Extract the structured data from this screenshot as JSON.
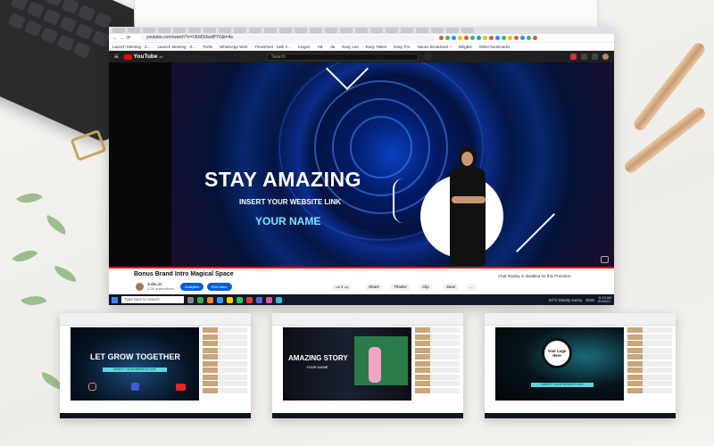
{
  "browser": {
    "url": "youtube.com/watch?v=VEMS0wdPY0&t=4s",
    "bookmarks": [
      "Launch Meeting - Z...",
      "Launch Meeting - Z...",
      "Trello",
      "WhatsApp Web",
      "Timesheet - task 2...",
      "Lingoo",
      "AB",
      "Jia",
      "Easy Lan",
      "Easy Talent",
      "Easy Pro",
      "Naomi Broadcast ~",
      "DiligBiz",
      "Other bookmarks"
    ]
  },
  "youtube": {
    "logo": "YouTube",
    "region": "MY",
    "search_placeholder": "Search",
    "video": {
      "headline": "STAY AMAZING",
      "subline": "INSERT YOUR WEBSITE LINK",
      "name": "YOUR NAME",
      "progress": 1.0
    },
    "title": "Bonus Brand Intro Magical Space",
    "channel": "JulieLim",
    "subscribers": "1.2K subscribers",
    "analytics_label": "Analytics",
    "edit_video_label": "Edit video",
    "likes": "4",
    "share_label": "Share",
    "thanks_label": "Thanks",
    "clip_label": "Clip",
    "save_label": "Save",
    "more_label": "...",
    "chat_notice": "Chat Replay is disabled for this Premiere."
  },
  "taskbar": {
    "search_placeholder": "Type here to search",
    "weather": "24°C  Mostly sunny",
    "lang": "ENG",
    "time": "11:15 AM",
    "date": "6/1/2021"
  },
  "thumbnails": [
    {
      "headline": "LET GROW TOGETHER",
      "pill": "INSERT YOUR WEBSITE LINK"
    },
    {
      "headline": "AMAZING STORY",
      "sub": "YOUR NAME"
    },
    {
      "logo_text": "Your Logo Here",
      "pill": "INSERT YOUR WEBSITE LINK"
    }
  ],
  "colors": {
    "youtube_red": "#ff0000",
    "accent_cyan": "#78e6ff",
    "blue_button": "#065fd4"
  }
}
